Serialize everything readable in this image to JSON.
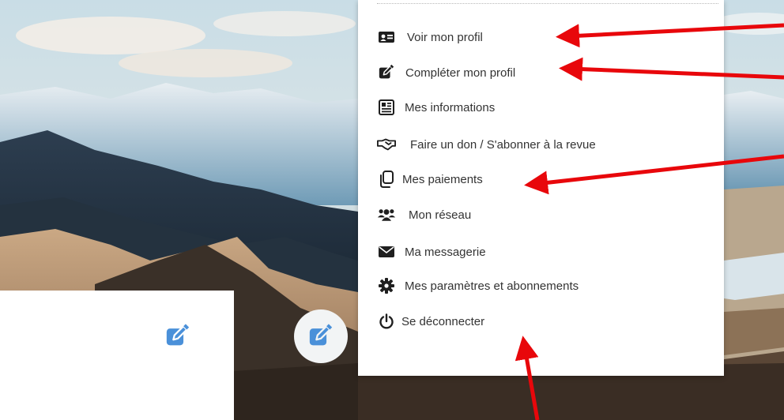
{
  "menu": {
    "items": [
      {
        "label": "Voir mon profil",
        "icon": "id-card-icon"
      },
      {
        "label": "Compléter mon profil",
        "icon": "edit-icon"
      },
      {
        "label": "Mes informations",
        "icon": "newspaper-icon"
      },
      {
        "label": "Faire un don / S'abonner à la revue",
        "icon": "handshake-icon"
      },
      {
        "label": "Mes paiements",
        "icon": "copy-icon"
      },
      {
        "label": "Mon réseau",
        "icon": "users-icon"
      },
      {
        "label": "Ma messagerie",
        "icon": "envelope-icon"
      },
      {
        "label": "Mes paramètres et abonnements",
        "icon": "gear-icon"
      },
      {
        "label": "Se déconnecter",
        "icon": "power-icon"
      }
    ]
  },
  "edit_buttons": [
    {
      "icon": "edit-icon"
    },
    {
      "icon": "edit-icon"
    }
  ],
  "colors": {
    "accent": "#4a90d9",
    "icon_dark": "#1f1f1f",
    "annotation_arrow": "#e8070b",
    "menu_text": "#333333"
  }
}
